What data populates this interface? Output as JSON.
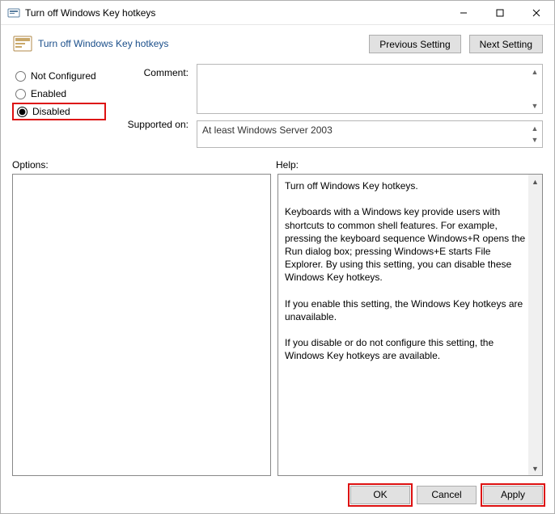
{
  "titlebar": {
    "title": "Turn off Windows Key hotkeys"
  },
  "header": {
    "title": "Turn off Windows Key hotkeys",
    "prev": "Previous Setting",
    "next": "Next Setting"
  },
  "radios": {
    "not_configured": "Not Configured",
    "enabled": "Enabled",
    "disabled": "Disabled",
    "selected": "disabled"
  },
  "labels": {
    "comment": "Comment:",
    "supported": "Supported on:",
    "options": "Options:",
    "help": "Help:"
  },
  "fields": {
    "comment": "",
    "supported": "At least Windows Server 2003"
  },
  "help_text": "Turn off Windows Key hotkeys.\n\nKeyboards with a Windows key provide users with shortcuts to common shell features. For example, pressing the keyboard sequence Windows+R opens the Run dialog box; pressing Windows+E starts File Explorer. By using this setting, you can disable these Windows Key hotkeys.\n\nIf you enable this setting, the Windows Key hotkeys are unavailable.\n\nIf you disable or do not configure this setting, the Windows Key hotkeys are available.",
  "footer": {
    "ok": "OK",
    "cancel": "Cancel",
    "apply": "Apply"
  }
}
